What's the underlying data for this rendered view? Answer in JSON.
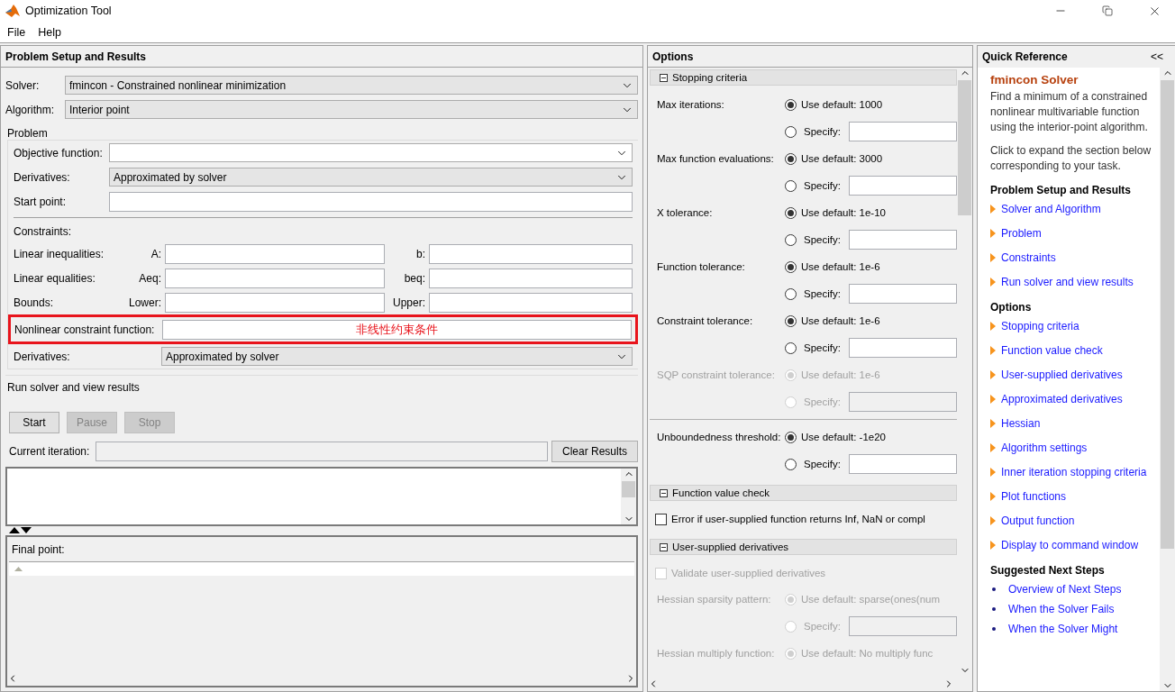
{
  "window": {
    "title": "Optimization Tool"
  },
  "menu": [
    "File",
    "Help"
  ],
  "problem_setup": {
    "title": "Problem Setup and Results",
    "solver": {
      "label": "Solver:",
      "value": "fmincon - Constrained nonlinear minimization"
    },
    "algorithm": {
      "label": "Algorithm:",
      "value": "Interior point"
    },
    "problem": {
      "title": "Problem",
      "objective": {
        "label": "Objective function:"
      },
      "derivatives": {
        "label": "Derivatives:",
        "value": "Approximated by solver"
      },
      "start_point": {
        "label": "Start point:"
      }
    },
    "constraints": {
      "title": "Constraints:",
      "rows": [
        {
          "label": "Linear inequalities:",
          "left": "A:",
          "right": "b:"
        },
        {
          "label": "Linear equalities:",
          "left": "Aeq:",
          "right": "beq:"
        },
        {
          "label": "Bounds:",
          "left": "Lower:",
          "right": "Upper:"
        }
      ],
      "nonlinear": {
        "label": "Nonlinear constraint function:",
        "annotation": "非线性约束条件"
      },
      "derivatives": {
        "label": "Derivatives:",
        "value": "Approximated by solver"
      }
    },
    "run": {
      "title": "Run solver and view results",
      "buttons": [
        {
          "label": "Start",
          "disabled": false
        },
        {
          "label": "Pause",
          "disabled": true
        },
        {
          "label": "Stop",
          "disabled": true
        }
      ],
      "current_iteration": {
        "label": "Current iteration:"
      },
      "clear_button": "Clear Results",
      "final_point": {
        "label": "Final point:"
      }
    }
  },
  "options": {
    "title": "Options",
    "sections": [
      {
        "title": "Stopping criteria",
        "expanded": true,
        "items": [
          {
            "kind": "choice",
            "label": "Max iterations:",
            "disabled": false,
            "choices": [
              {
                "kind": "default",
                "label": "Use default: 1000",
                "selected": true
              },
              {
                "kind": "specify",
                "label": "Specify:",
                "selected": false
              }
            ]
          },
          {
            "kind": "choice",
            "label": "Max function evaluations:",
            "disabled": false,
            "choices": [
              {
                "kind": "default",
                "label": "Use default: 3000",
                "selected": true
              },
              {
                "kind": "specify",
                "label": "Specify:",
                "selected": false
              }
            ]
          },
          {
            "kind": "choice",
            "label": "X tolerance:",
            "disabled": false,
            "choices": [
              {
                "kind": "default",
                "label": "Use default: 1e-10",
                "selected": true
              },
              {
                "kind": "specify",
                "label": "Specify:",
                "selected": false
              }
            ]
          },
          {
            "kind": "choice",
            "label": "Function tolerance:",
            "disabled": false,
            "choices": [
              {
                "kind": "default",
                "label": "Use default: 1e-6",
                "selected": true
              },
              {
                "kind": "specify",
                "label": "Specify:",
                "selected": false
              }
            ]
          },
          {
            "kind": "choice",
            "label": "Constraint tolerance:",
            "disabled": false,
            "choices": [
              {
                "kind": "default",
                "label": "Use default: 1e-6",
                "selected": true
              },
              {
                "kind": "specify",
                "label": "Specify:",
                "selected": false
              }
            ]
          },
          {
            "kind": "choice",
            "label": "SQP constraint tolerance:",
            "disabled": true,
            "choices": [
              {
                "kind": "default",
                "label": "Use default: 1e-6",
                "selected": true
              },
              {
                "kind": "specify",
                "label": "Specify:",
                "selected": false
              }
            ]
          },
          {
            "kind": "choice",
            "label": "Unboundedness threshold:",
            "disabled": false,
            "divided": true,
            "choices": [
              {
                "kind": "default",
                "label": "Use default: -1e20",
                "selected": true
              },
              {
                "kind": "specify",
                "label": "Specify:",
                "selected": false
              }
            ]
          }
        ]
      },
      {
        "title": "Function value check",
        "expanded": true,
        "items": [
          {
            "kind": "checkbox",
            "label": "Error if user-supplied function returns Inf, NaN or compl",
            "checked": false,
            "disabled": false
          }
        ]
      },
      {
        "title": "User-supplied derivatives",
        "expanded": true,
        "items": [
          {
            "kind": "checkbox",
            "label": "Validate user-supplied derivatives",
            "checked": false,
            "disabled": true
          },
          {
            "kind": "choice",
            "label": "Hessian sparsity pattern:",
            "disabled": true,
            "choices": [
              {
                "kind": "default",
                "label": "Use default: sparse(ones(num",
                "selected": true
              },
              {
                "kind": "specify",
                "label": "Specify:",
                "selected": false
              }
            ]
          },
          {
            "kind": "choice",
            "label": "Hessian multiply function:",
            "disabled": true,
            "choices": [
              {
                "kind": "default",
                "label": "Use default: No multiply func",
                "selected": true
              }
            ]
          }
        ]
      }
    ]
  },
  "quick_reference": {
    "title": "Quick Reference",
    "collapse": "<<",
    "heading": "fmincon Solver",
    "paragraphs": [
      "Find a minimum of a constrained nonlinear multivariable function using the interior-point algorithm.",
      "Click to expand the section below corresponding to your task."
    ],
    "sections": [
      {
        "title": "Problem Setup and Results",
        "kind": "arrow",
        "links": [
          "Solver and Algorithm",
          "Problem",
          "Constraints",
          "Run solver and view results"
        ]
      },
      {
        "title": "Options",
        "kind": "arrow",
        "links": [
          "Stopping criteria",
          "Function value check",
          "User-supplied derivatives",
          "Approximated derivatives",
          "Hessian",
          "Algorithm settings",
          "Inner iteration stopping criteria",
          "Plot functions",
          "Output function",
          "Display to command window"
        ]
      },
      {
        "title": "Suggested Next Steps",
        "kind": "bullet",
        "links": [
          "Overview of Next Steps",
          "When the Solver Fails",
          "When the Solver Might"
        ]
      }
    ]
  }
}
